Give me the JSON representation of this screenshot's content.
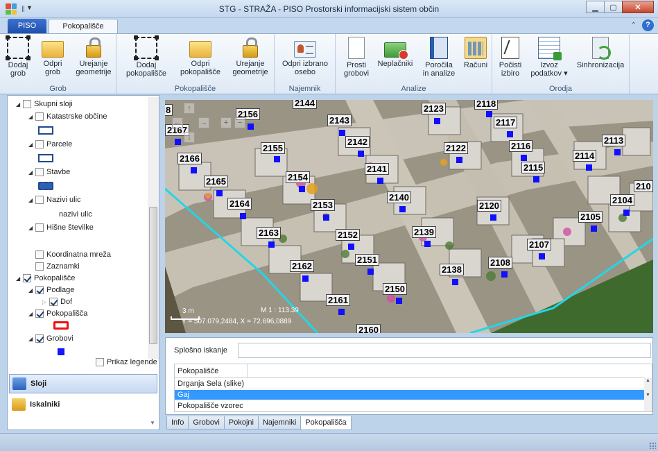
{
  "window": {
    "title": "STG - STRAŽA - PISO Prostorski informacijski sistem občin",
    "minimize": "▁",
    "maximize": "▢",
    "close": "✕"
  },
  "tabs": {
    "app_tab": "PISO",
    "active_tab": "Pokopališče",
    "help": "?",
    "collapse": "⌃"
  },
  "ribbon": {
    "groups": {
      "grob": "Grob",
      "pokopalisce": "Pokopališče",
      "najemnik": "Najemnik",
      "analize": "Analize",
      "orodja": "Orodja"
    },
    "buttons": {
      "dodaj_grob": [
        "Dodaj",
        "grob"
      ],
      "odpri_grob": [
        "Odpri",
        "grob"
      ],
      "urejanje_geometrije_1": [
        "Urejanje",
        "geometrije"
      ],
      "dodaj_pokopalisce": [
        "Dodaj",
        "pokopališče"
      ],
      "odpri_pokopalisce": [
        "Odpri",
        "pokopališče"
      ],
      "urejanje_geometrije_2": [
        "Urejanje",
        "geometrije"
      ],
      "odpri_osebo": [
        "Odpri izbrano",
        "osebo"
      ],
      "prosti_grobovi": [
        "Prosti",
        "grobovi"
      ],
      "neplacniki": [
        "Neplačniki",
        ""
      ],
      "porocila": [
        "Poročila",
        "in analize"
      ],
      "racuni": [
        "Računi",
        ""
      ],
      "pocisti": [
        "Počisti",
        "izbiro"
      ],
      "izvoz": [
        "Izvoz",
        "podatkov ▾"
      ],
      "sinhronizacija": [
        "Sinhronizacija",
        ""
      ]
    }
  },
  "layers": {
    "items": [
      {
        "label": "Skupni sloji",
        "checked": false
      },
      {
        "label": "Katastrske občine",
        "checked": false
      },
      {
        "label": "Parcele",
        "checked": false
      },
      {
        "label": "Stavbe",
        "checked": false
      },
      {
        "label": "Nazivi ulic",
        "checked": false
      },
      {
        "label": "nazivi ulic",
        "checked": false
      },
      {
        "label": "Hišne številke",
        "checked": false
      },
      {
        "label": "Koordinatna mreža",
        "checked": false
      },
      {
        "label": "Zaznamki",
        "checked": false
      },
      {
        "label": "Pokopališče",
        "checked": true
      },
      {
        "label": "Podlage",
        "checked": true
      },
      {
        "label": "Dof",
        "checked": true
      },
      {
        "label": "Pokopališča",
        "checked": true
      },
      {
        "label": "Grobovi",
        "checked": true
      }
    ],
    "legend_toggle": "Prikaz legende"
  },
  "side_panels": {
    "sloji": "Sloji",
    "iskalniki": "Iskalniki"
  },
  "map": {
    "graves": [
      {
        "id": "2144"
      },
      {
        "id": "2156"
      },
      {
        "id": "2167"
      },
      {
        "id": "2143"
      },
      {
        "id": "2118"
      },
      {
        "id": "2123"
      },
      {
        "id": "2117"
      },
      {
        "id": "2142"
      },
      {
        "id": "2155"
      },
      {
        "id": "2122"
      },
      {
        "id": "2116"
      },
      {
        "id": "2113"
      },
      {
        "id": "2166"
      },
      {
        "id": "2114"
      },
      {
        "id": "2141"
      },
      {
        "id": "2115"
      },
      {
        "id": "2154"
      },
      {
        "id": "2165"
      },
      {
        "id": "210"
      },
      {
        "id": "2140"
      },
      {
        "id": "2104"
      },
      {
        "id": "2164"
      },
      {
        "id": "2153"
      },
      {
        "id": "2120"
      },
      {
        "id": "2105"
      },
      {
        "id": "2163"
      },
      {
        "id": "2152"
      },
      {
        "id": "2139"
      },
      {
        "id": "2107"
      },
      {
        "id": "2151"
      },
      {
        "id": "2162"
      },
      {
        "id": "2108"
      },
      {
        "id": "2138"
      },
      {
        "id": "2150"
      },
      {
        "id": "2161"
      },
      {
        "id": "2160"
      },
      {
        "id": "8"
      }
    ],
    "nav": {
      "up": "↑",
      "left": "←",
      "right": "→",
      "down": "↓",
      "zoom_in": "+",
      "zoom_out": "−"
    },
    "scale_length": "3 m",
    "scale_ratio": "M 1 : 113.39",
    "coordinates": "Y = 507.079,2484, X = 72.696,0889"
  },
  "search": {
    "label": "Splošno iskanje",
    "value": "",
    "grid_header": "Pokopališče",
    "rows": [
      "Drganja Sela (slike)",
      "Gaj",
      "Pokopališče vzorec"
    ],
    "selected_row": "Gaj"
  },
  "bottom_tabs": [
    "Info",
    "Grobovi",
    "Pokojni",
    "Najemniki",
    "Pokopališča"
  ],
  "active_bottom_tab": "Pokopališča"
}
